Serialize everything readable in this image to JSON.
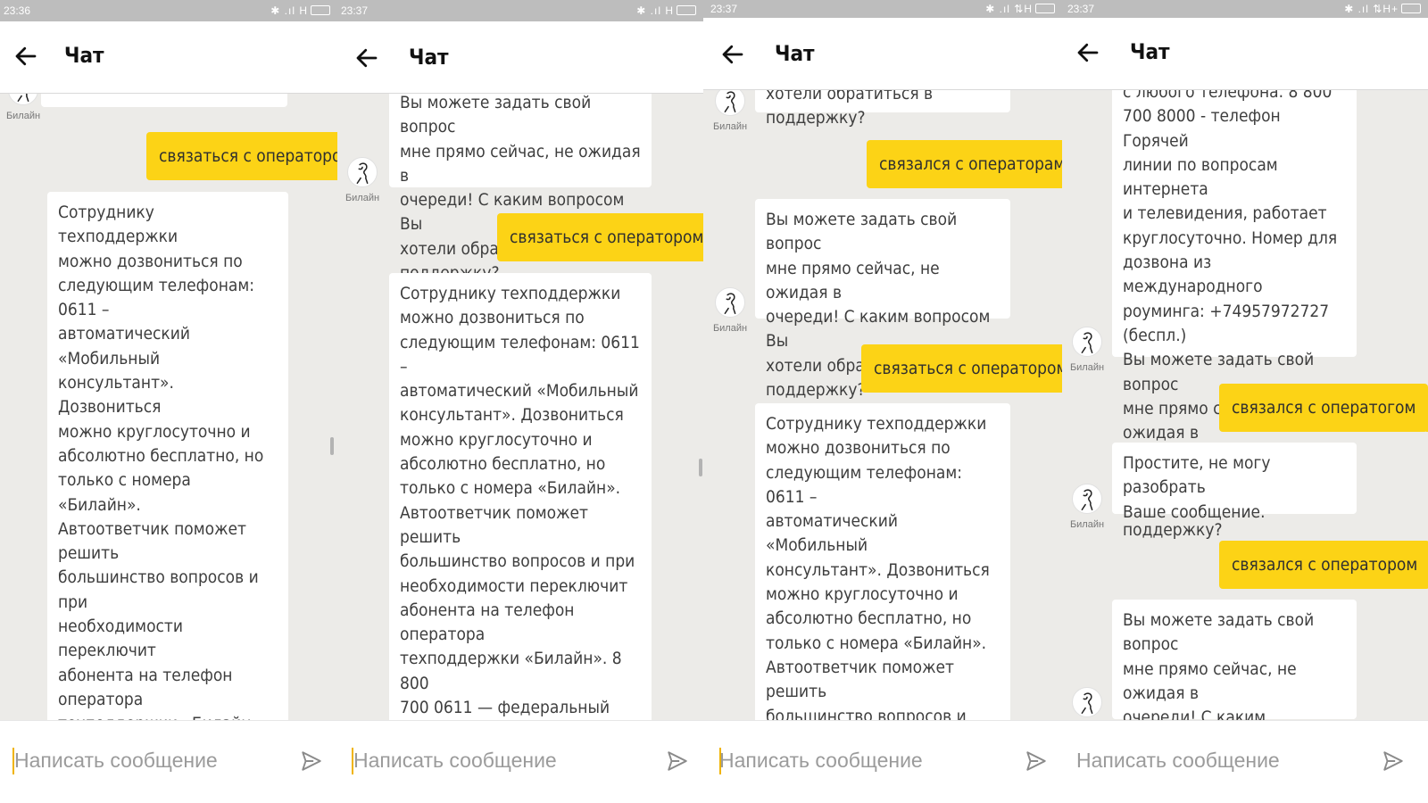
{
  "app": {
    "title": "Чат",
    "input_placeholder": "Написать сообщение",
    "bot_name": "Билайн"
  },
  "colors": {
    "accent_yellow": "#fcd316",
    "background": "#ecebe8",
    "statusbar": "#bdbdbd"
  },
  "icons": [
    "back-arrow-icon",
    "send-icon",
    "beeline-avatar-icon",
    "bluetooth-icon",
    "signal-icon",
    "battery-icon"
  ],
  "panels": [
    {
      "time": "23:36",
      "status_icons": "✱ .ıl H",
      "messages": [
        {
          "type": "bot",
          "text": ""
        },
        {
          "type": "user",
          "text": "связаться с оператором"
        },
        {
          "type": "bot",
          "text": "Сотруднику техподдержки\nможно дозвониться по\nследующим телефонам: 0611 –\nавтоматический «Мобильный\nконсультант». Дозвониться\nможно круглосуточно и\nабсолютно бесплатно, но\nтолько с номера «Билайн».\nАвтоответчик поможет решить\nбольшинство вопросов и при\nнеобходимости переключит\nабонента на телефон оператора\nтехподдержки «Билайн». 8 800\n700 0611 — федеральный номер\n«Мобильного консультанта»,\nна который можно дозвониться\nс любого телефона. 8 800\n700 8000 - телефон Горячей\nлинии по вопросам интернета\nи телевидения, работает\nкруглосуточно. Номер для"
        }
      ]
    },
    {
      "time": "23:37",
      "status_icons": "✱ .ıl H",
      "messages": [
        {
          "type": "bot",
          "text": "Вы можете задать свой вопрос\nмне прямо сейчас, не ожидая в\nочереди! С каким вопросом Вы\nхотели обратиться в поддержку?"
        },
        {
          "type": "user",
          "text": "связаться с оператором"
        },
        {
          "type": "bot",
          "text": "Сотруднику техподдержки\nможно дозвониться по\nследующим телефонам: 0611 –\nавтоматический «Мобильный\nконсультант». Дозвониться\nможно круглосуточно и\nабсолютно бесплатно, но\nтолько с номера «Билайн».\nАвтоответчик поможет решить\nбольшинство вопросов и при\nнеобходимости переключит\nабонента на телефон оператора\nтехподдержки «Билайн». 8 800\n700 0611 — федеральный номер\n«Мобильного консультанта»,\nна который можно дозвониться\nс любого телефона. 8 800\n700 8000 - телефон Горячей"
        }
      ]
    },
    {
      "time": "23:37",
      "status_icons": "✱ .ıl ⇅H",
      "messages": [
        {
          "type": "bot",
          "text": "хотели обратиться в поддержку?"
        },
        {
          "type": "user",
          "text": "связался с операторам"
        },
        {
          "type": "bot",
          "text": "Вы можете задать свой вопрос\nмне прямо сейчас, не ожидая в\nочереди! С каким вопросом Вы\nхотели обратиться в поддержку?"
        },
        {
          "type": "user",
          "text": "связаться с оператором"
        },
        {
          "type": "bot",
          "text": "Сотруднику техподдержки\nможно дозвониться по\nследующим телефонам: 0611 –\nавтоматический «Мобильный\nконсультант». Дозвониться\nможно круглосуточно и\nабсолютно бесплатно, но\nтолько с номера «Билайн».\nАвтоответчик поможет решить\nбольшинство вопросов и при\nнеобходимости переключит\nабонента на телефон оператора"
        }
      ]
    },
    {
      "time": "23:37",
      "status_icons": "✱ .ıl ⇅H+",
      "messages": [
        {
          "type": "bot",
          "text": "с любого телефона. 8 800\n700 8000 - телефон Горячей\nлинии по вопросам интернета\nи телевидения, работает\nкруглосуточно. Номер для\nдозвона из международного\nроуминга: +74957972727 (беспл.)\nВы можете задать свой вопрос\nмне прямо сейчас, не ожидая в\nочереди! С каким вопросом Вы\nхотели обратиться в поддержку?"
        },
        {
          "type": "user",
          "text": "связался с оператогом"
        },
        {
          "type": "bot",
          "text": "Простите, не могу разобрать\nВаше сообщение."
        },
        {
          "type": "user",
          "text": "связался с оператором"
        },
        {
          "type": "bot",
          "text": "Вы можете задать свой вопрос\nмне прямо сейчас, не ожидая в\nочереди! С каким вопросом Вы\nхотели обратиться в поддержку?"
        }
      ]
    }
  ]
}
